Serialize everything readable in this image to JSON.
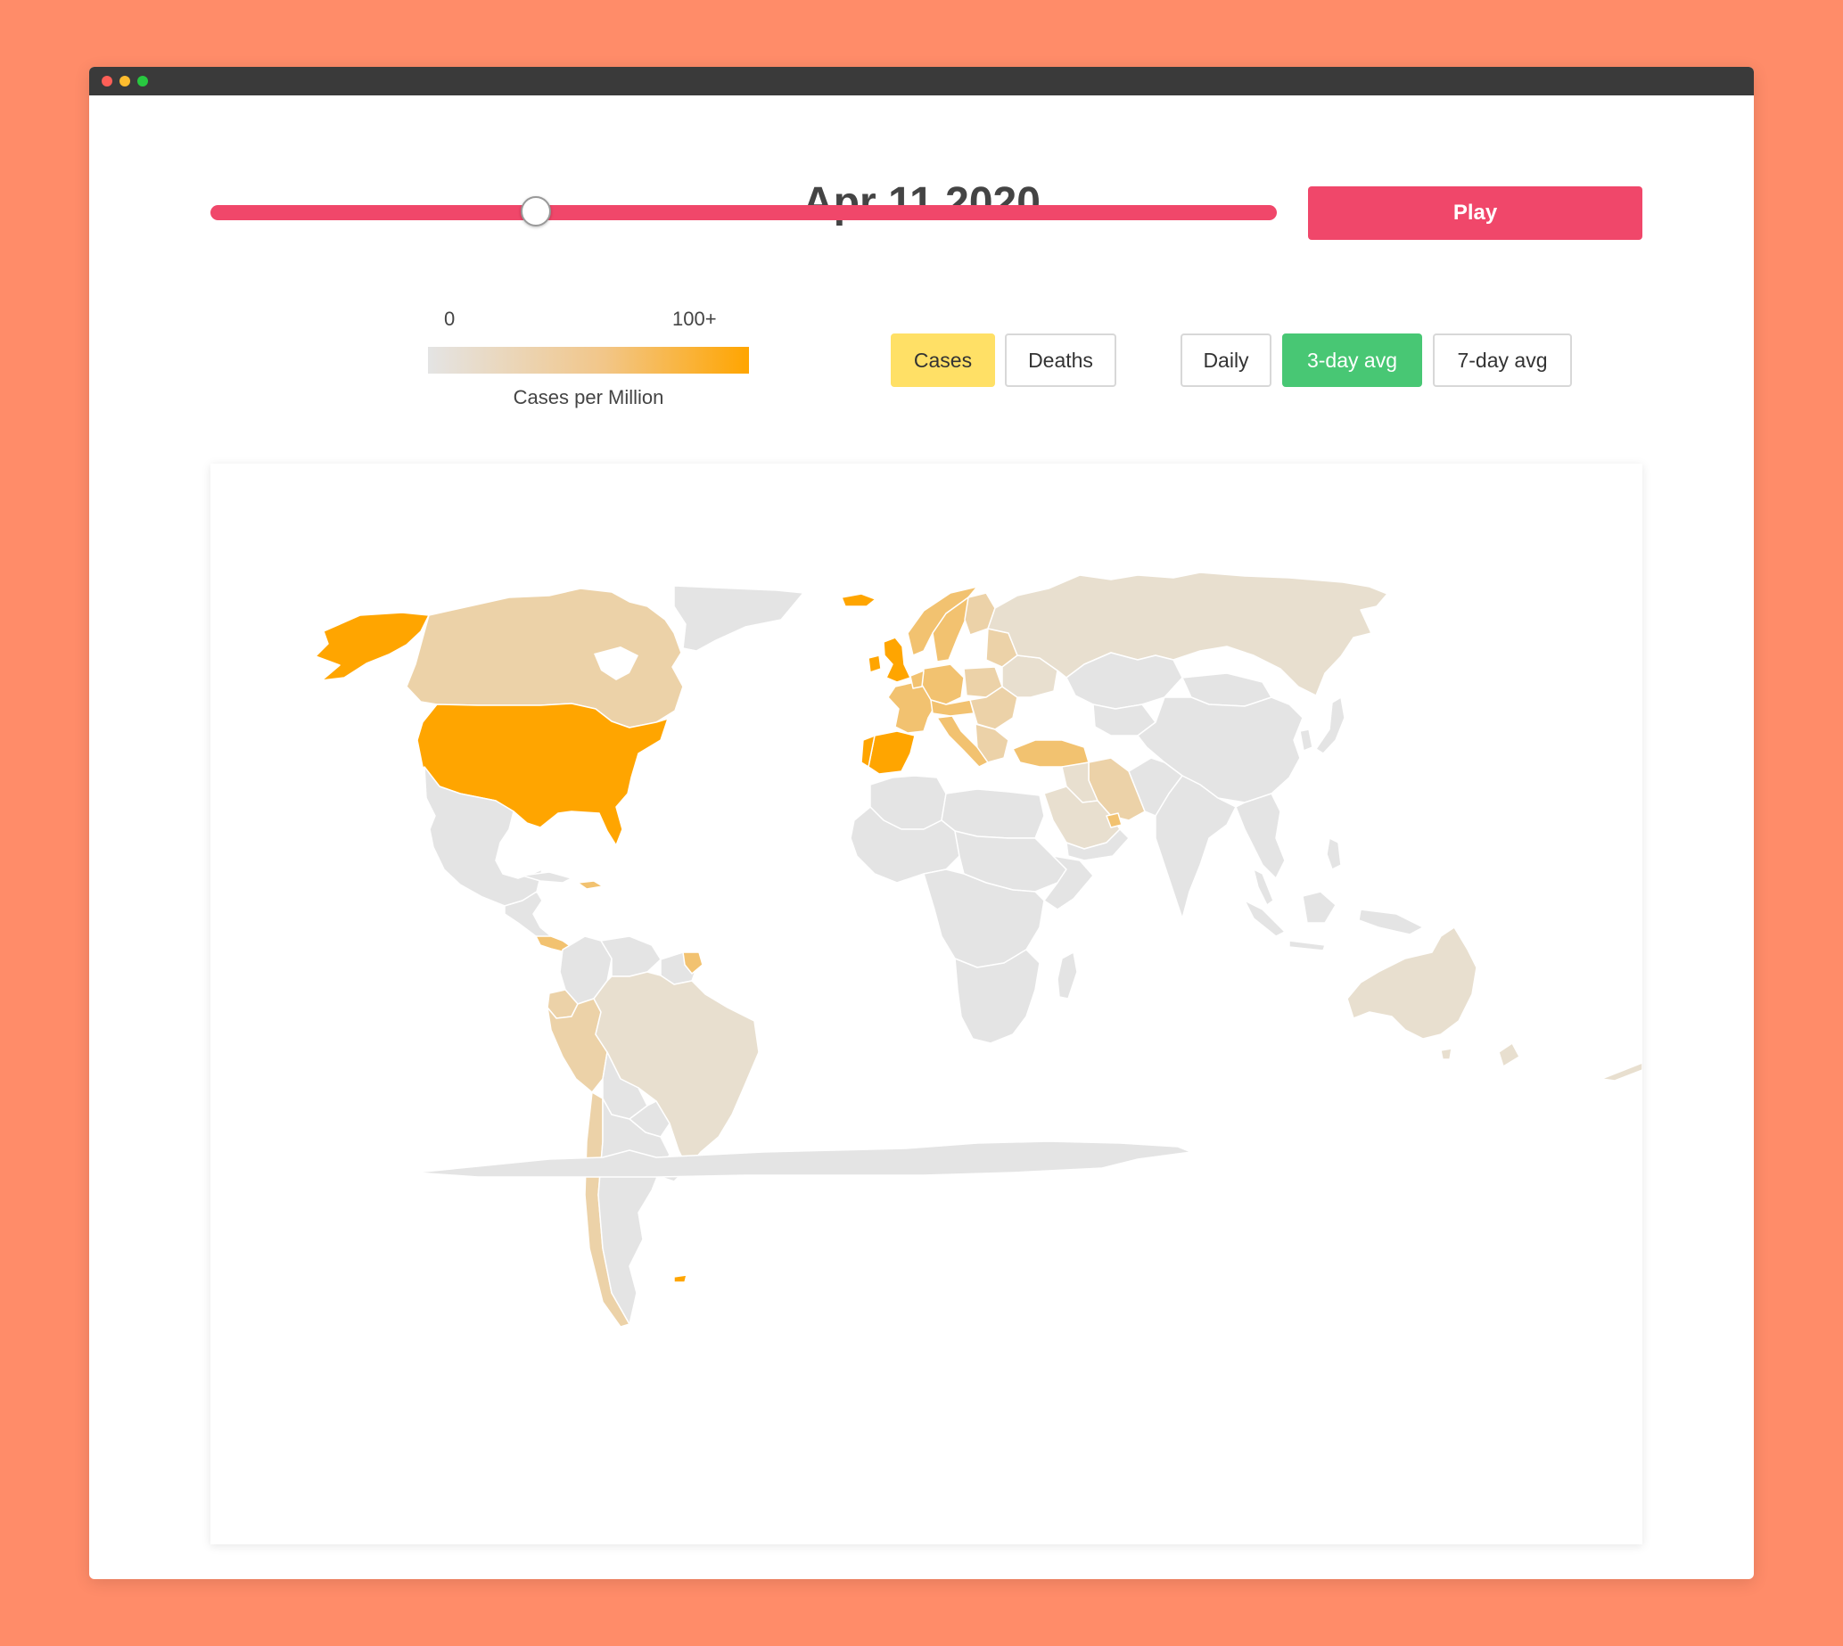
{
  "header": {
    "date": "Apr 11 2020"
  },
  "timeline": {
    "position": 0.305,
    "track_color": "#f0476a"
  },
  "controls": {
    "play_label": "Play",
    "metric": [
      {
        "label": "Cases",
        "active": true
      },
      {
        "label": "Deaths",
        "active": false
      }
    ],
    "window": [
      {
        "label": "Daily",
        "active": false
      },
      {
        "label": "3-day avg",
        "active": true
      },
      {
        "label": "7-day avg",
        "active": false
      }
    ]
  },
  "legend": {
    "min_label": "0",
    "max_label": "100+",
    "caption": "Cases per Million",
    "color_low": "#e4e4e4",
    "color_high": "#ffa500"
  },
  "colors": {
    "background": "#ff8c69",
    "play_button": "#f0476a",
    "cases_active": "#ffe066",
    "window_active": "#48c774",
    "no_data": "#e4e4e4",
    "very_low": "#e8dfcf",
    "low": "#ecd2a8",
    "medium": "#f2c270",
    "high": "#ffa500"
  }
}
